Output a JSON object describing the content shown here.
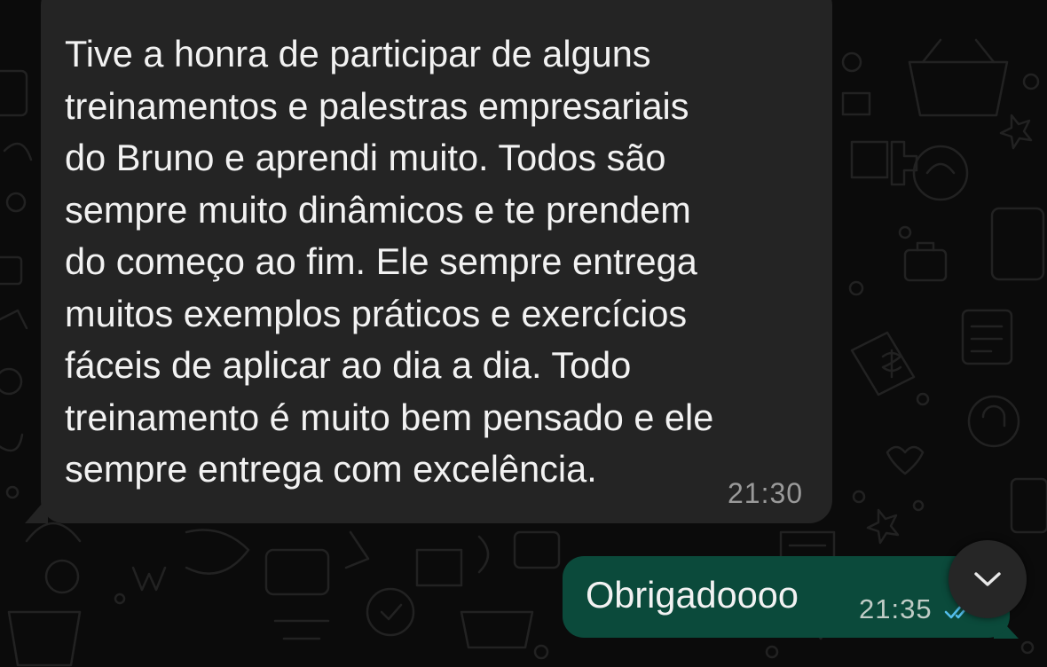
{
  "chat": {
    "incoming": {
      "text": "Tive a honra de participar de alguns\ntreinamentos e palestras empresariais\ndo Bruno e aprendi muito. Todos são\nsempre muito dinâmicos e te prendem\ndo começo ao fim. Ele sempre entrega\nmuitos exemplos práticos e exercícios\nfáceis de aplicar ao dia a dia. Todo\ntreinamento é muito bem pensado e ele\nsempre entrega com excelência.",
      "time": "21:30"
    },
    "outgoing": {
      "text": "Obrigadoooo",
      "time": "21:35",
      "status": "read"
    }
  },
  "colors": {
    "incoming_bubble": "#242424",
    "outgoing_bubble": "#0b4a3b",
    "read_ticks": "#53bdeb",
    "background": "#0b0b0b"
  },
  "icons": {
    "status": "double-check-icon",
    "scroll": "chevron-down-icon"
  }
}
